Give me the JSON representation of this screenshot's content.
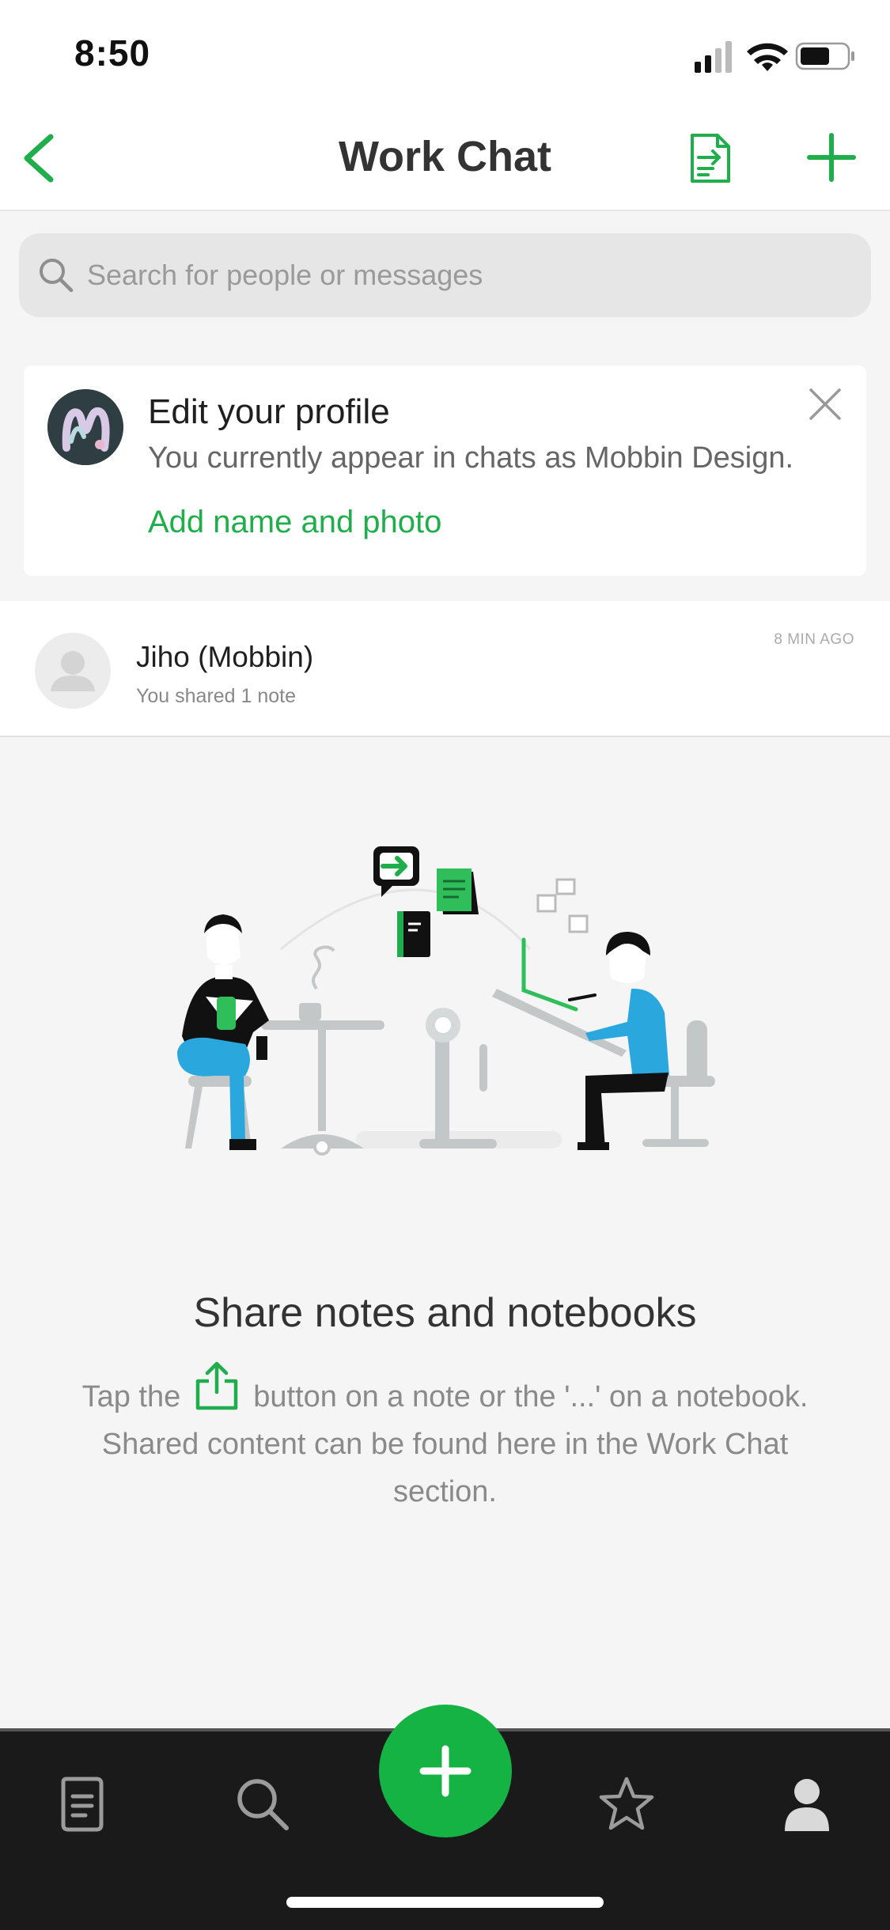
{
  "status_bar": {
    "time": "8:50"
  },
  "nav": {
    "title": "Work Chat"
  },
  "search": {
    "placeholder": "Search for people or messages"
  },
  "profile_card": {
    "title": "Edit your profile",
    "subtitle": "You currently appear in chats as Mobbin Design.",
    "link": "Add name and photo"
  },
  "chats": [
    {
      "name": "Jiho (Mobbin)",
      "preview": "You shared 1 note",
      "time": "8 MIN AGO"
    }
  ],
  "empty_state": {
    "title": "Share notes and notebooks",
    "body_before_icon": "Tap the",
    "body_after_icon": "button on a note or the '...' on a notebook. Shared content can be found here in the Work Chat section."
  },
  "tabs": [
    {
      "icon": "notes-icon"
    },
    {
      "icon": "search-icon"
    },
    {
      "icon": "add-icon"
    },
    {
      "icon": "star-icon"
    },
    {
      "icon": "account-icon"
    }
  ],
  "colors": {
    "accent": "#1fae4b",
    "fab": "#15b343",
    "tabbar": "#1a1a1a"
  }
}
